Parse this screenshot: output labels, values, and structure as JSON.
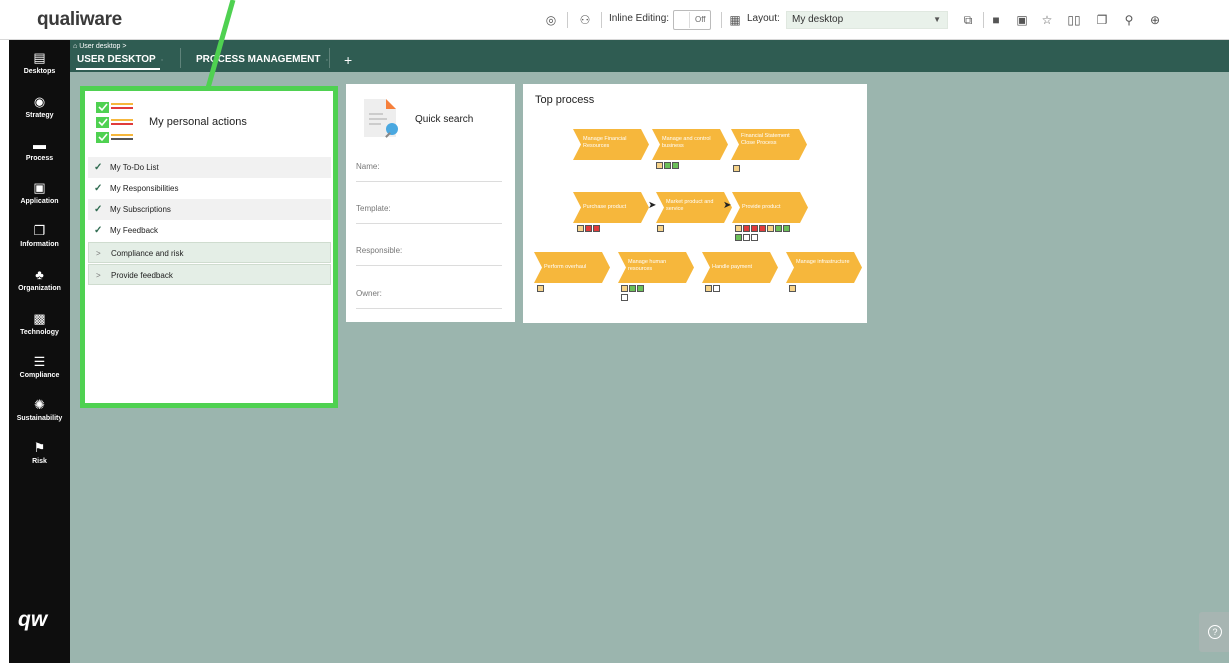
{
  "app": {
    "logo": "qualiware"
  },
  "header": {
    "inline_editing_label": "Inline Editing:",
    "inline_editing_value": "Off",
    "layout_label": "Layout:",
    "layout_value": "My desktop"
  },
  "sidebar": {
    "items": [
      {
        "label": "Desktops",
        "icon": "desktop-icon"
      },
      {
        "label": "Strategy",
        "icon": "target-icon"
      },
      {
        "label": "Process",
        "icon": "process-icon"
      },
      {
        "label": "Application",
        "icon": "application-icon"
      },
      {
        "label": "Information",
        "icon": "information-icon"
      },
      {
        "label": "Organization",
        "icon": "organization-icon"
      },
      {
        "label": "Technology",
        "icon": "chip-icon"
      },
      {
        "label": "Compliance",
        "icon": "checklist-icon"
      },
      {
        "label": "Sustainability",
        "icon": "sustainability-icon"
      },
      {
        "label": "Risk",
        "icon": "flag-icon"
      }
    ],
    "bottom_logo": "qw"
  },
  "breadcrumb": "User desktop >",
  "tabs": [
    {
      "label": "USER DESKTOP",
      "active": true
    },
    {
      "label": "PROCESS MANAGEMENT",
      "active": false
    }
  ],
  "personal_actions": {
    "title": "My personal actions",
    "items": [
      "My To-Do List",
      "My Responsibilities",
      "My Subscriptions",
      "My Feedback"
    ],
    "groups": [
      "Compliance and risk",
      "Provide feedback"
    ]
  },
  "quick_search": {
    "title": "Quick search",
    "fields": [
      "Name:",
      "Template:",
      "Responsible:",
      "Owner:"
    ]
  },
  "top_process": {
    "title": "Top process",
    "processes": [
      "Manage Financial Resources",
      "Manage and control business",
      "Financial Statement Close Process",
      "Purchase product",
      "Market product and service",
      "Provide product",
      "Perform overhaul",
      "Manage human resources",
      "Handle payment",
      "Manage infrastructure"
    ]
  },
  "colors": {
    "accent_green": "#2f5c52",
    "highlight": "#4fd151",
    "process_yellow": "#f6b73c"
  }
}
